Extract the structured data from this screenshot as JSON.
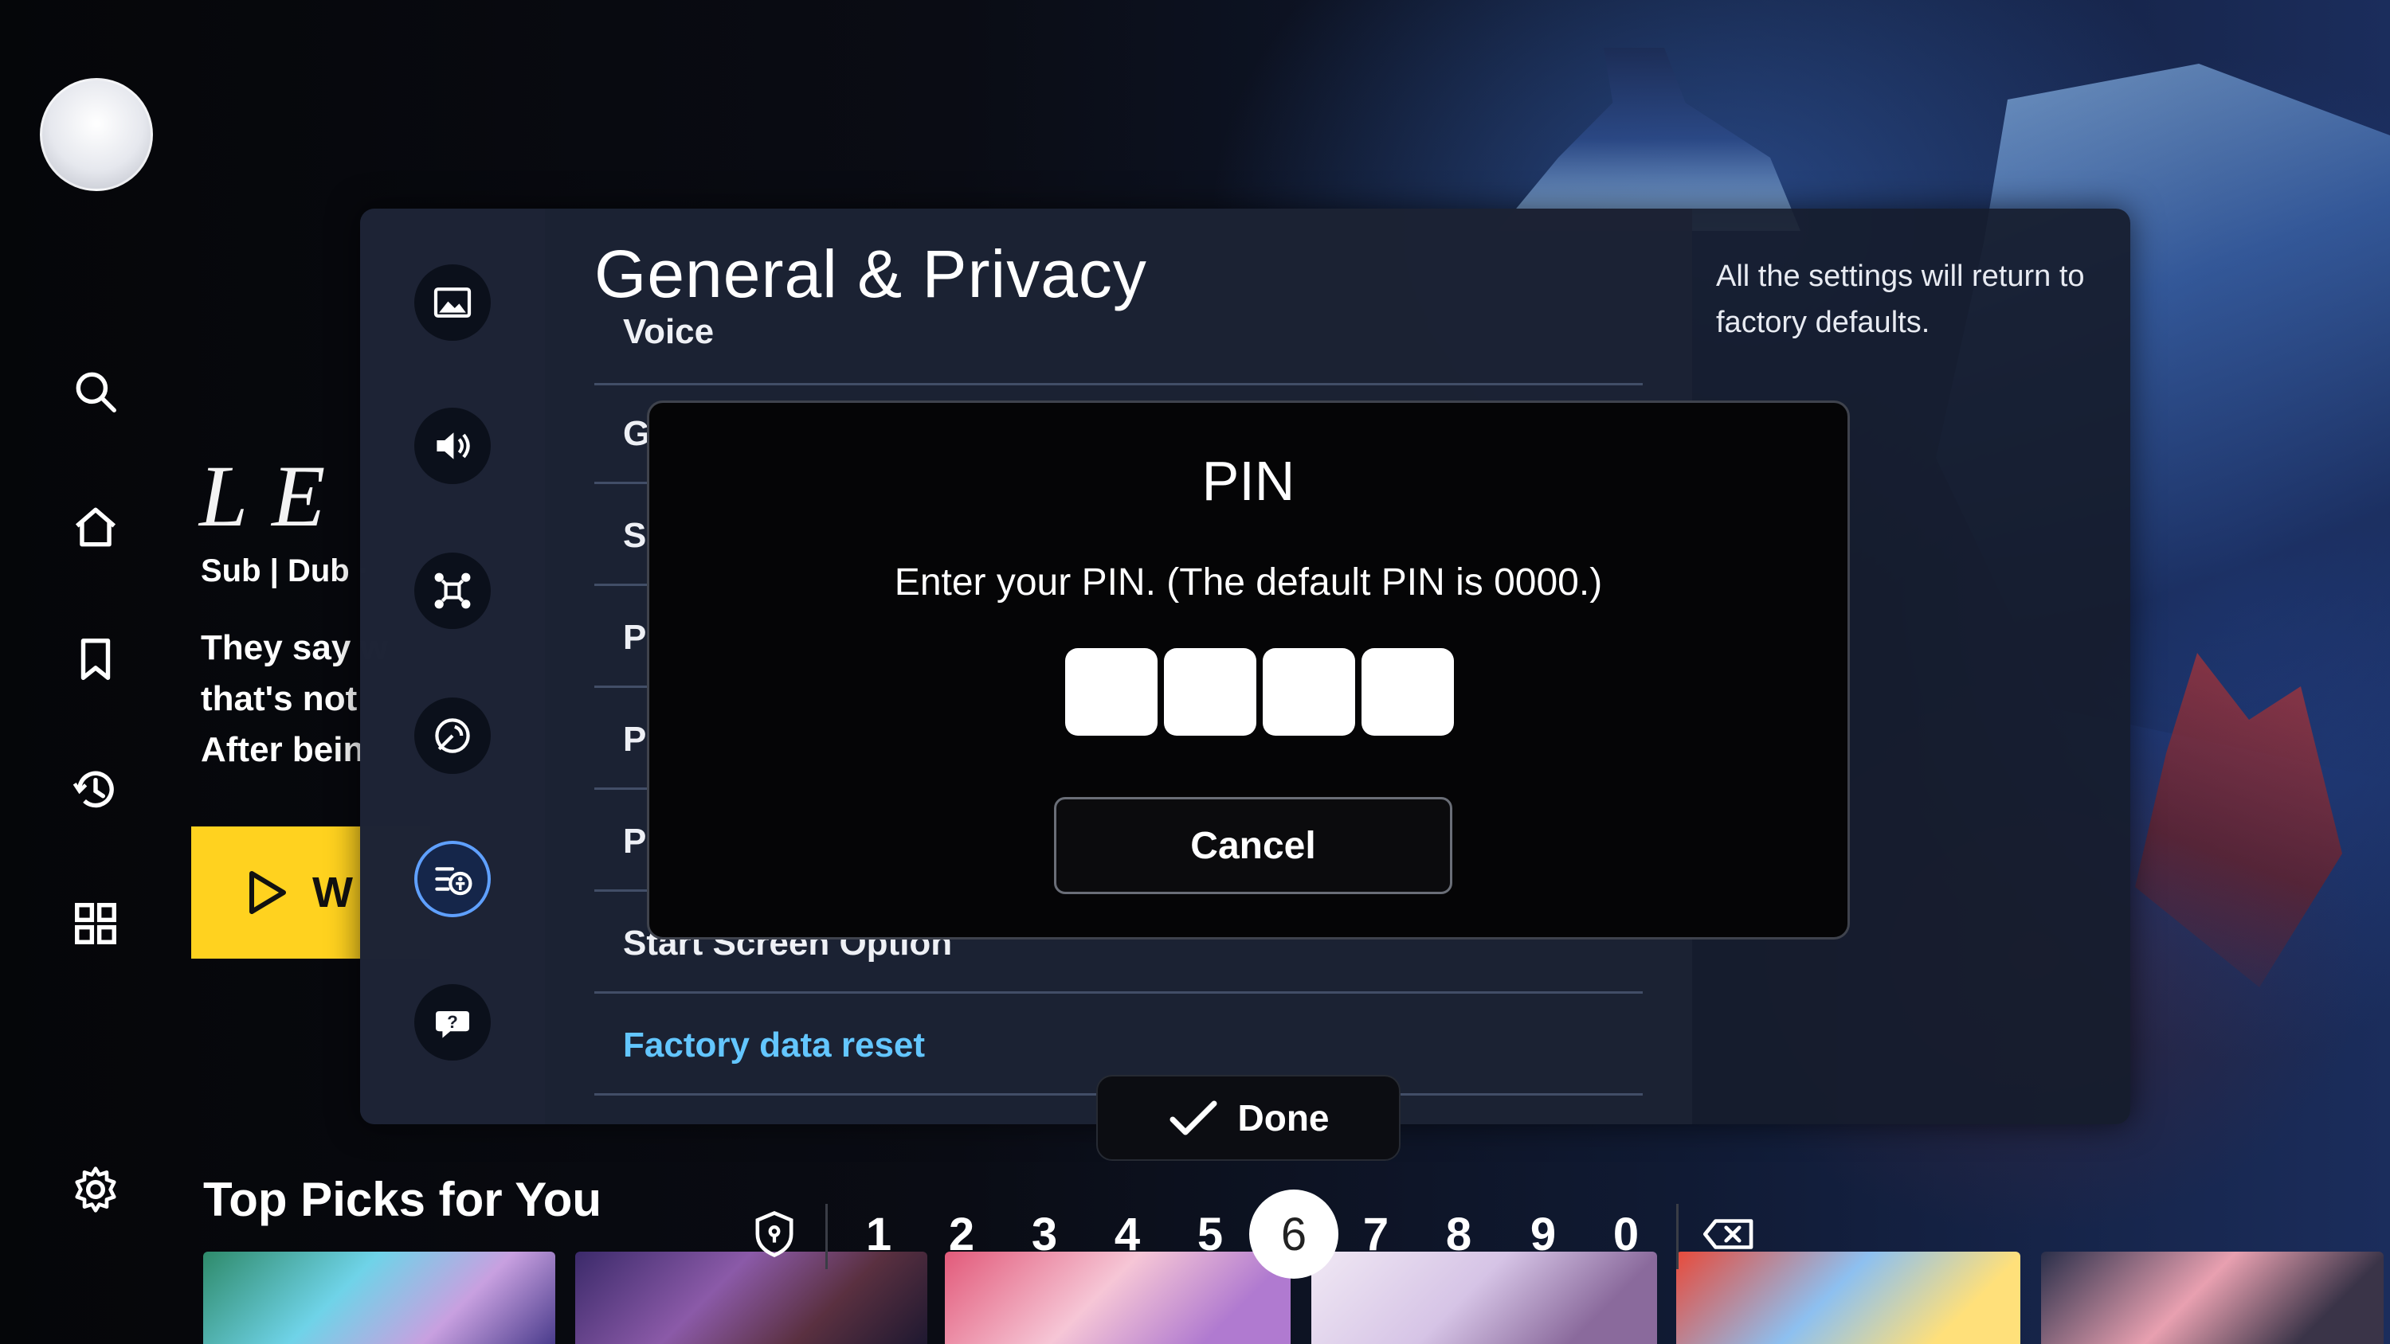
{
  "screen": {
    "accent_color": "#5fa0ff",
    "link_color": "#63c6ff",
    "watch_button_color": "#ffd21f"
  },
  "nav_rail": {
    "items": [
      {
        "icon": "search-icon"
      },
      {
        "icon": "home-icon"
      },
      {
        "icon": "bookmark-icon"
      },
      {
        "icon": "history-icon"
      },
      {
        "icon": "apps-grid-icon"
      },
      {
        "icon": "gear-icon"
      }
    ]
  },
  "hero": {
    "title": "LE",
    "meta": "Sub | Dub ·",
    "description_lines": [
      "They say w",
      "that's not",
      "After bein"
    ],
    "watch_label": "W"
  },
  "settings": {
    "title": "General & Privacy",
    "help_text": "All the settings will return to factory defaults.",
    "side_icons": [
      "picture-icon",
      "sound-icon",
      "connection-icon",
      "broadcast-icon",
      "general-privacy-icon",
      "support-icon"
    ],
    "active_side_icon": "general-privacy-icon",
    "rows": [
      {
        "label": "Voice"
      },
      {
        "label": "G"
      },
      {
        "label": "S"
      },
      {
        "label": "P"
      },
      {
        "label": "P"
      },
      {
        "label": "P"
      },
      {
        "label": "Start Screen Option"
      },
      {
        "label": "Factory data reset"
      }
    ]
  },
  "pin_dialog": {
    "title": "PIN",
    "message": "Enter your PIN. (The default PIN is 0000.)",
    "digit_count": 4,
    "cancel_label": "Cancel"
  },
  "keypad": {
    "done_label": "Done",
    "digits": [
      "1",
      "2",
      "3",
      "4",
      "5",
      "6",
      "7",
      "8",
      "9",
      "0"
    ],
    "focused_digit": "6"
  },
  "bottom_row": {
    "title": "Top Picks for You"
  }
}
